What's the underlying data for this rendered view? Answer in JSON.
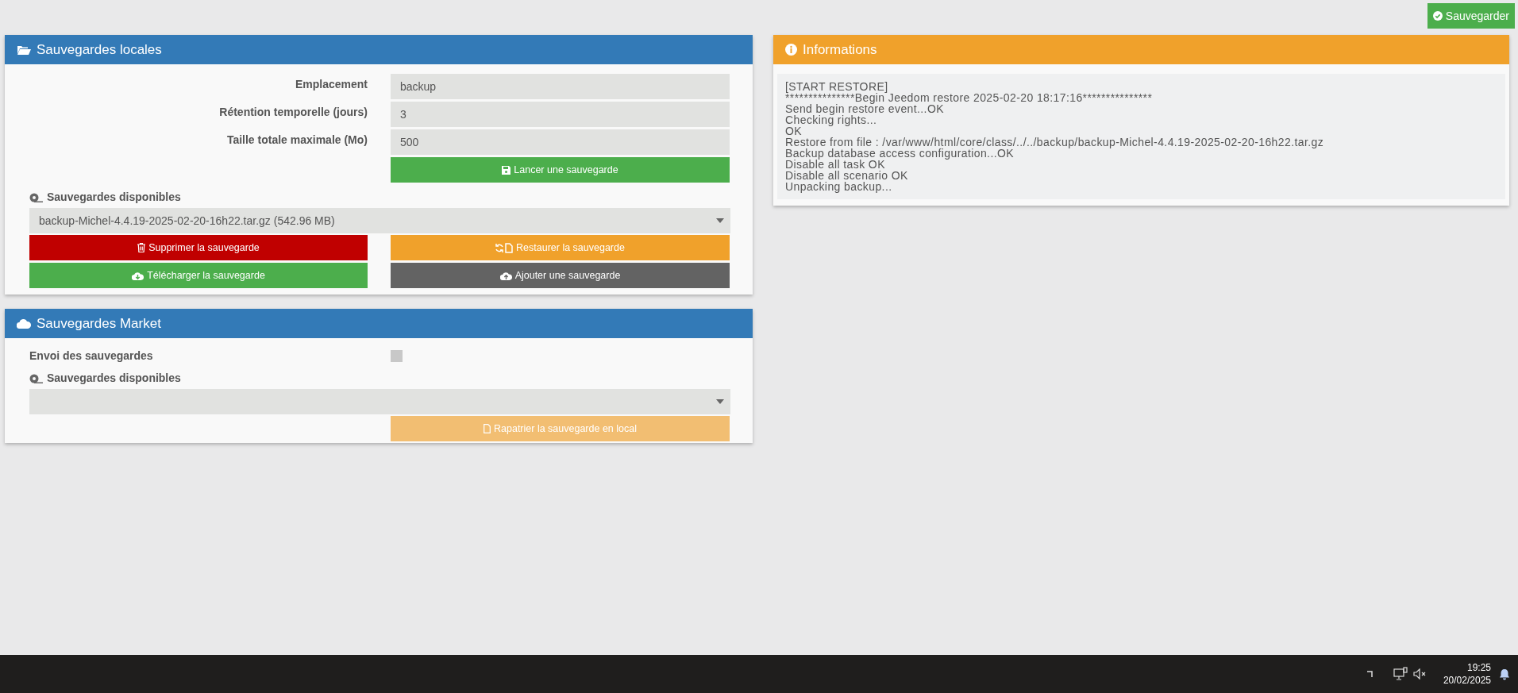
{
  "header_button": {
    "label": "Sauvegarder"
  },
  "local_backups": {
    "title": "Sauvegardes locales",
    "fields": [
      {
        "label": "Emplacement",
        "value": "backup"
      },
      {
        "label": "Rétention temporelle (jours)",
        "value": "3"
      },
      {
        "label": "Taille totale maximale (Mo)",
        "value": "500"
      }
    ],
    "launch_button": "Lancer une sauvegarde",
    "available_label": "Sauvegardes disponibles",
    "select_value": "backup-Michel-4.4.19-2025-02-20-16h22.tar.gz (542.96 MB)",
    "buttons": [
      {
        "label": "Supprimer la sauvegarde",
        "kind": "delete"
      },
      {
        "label": "Restaurer la sauvegarde",
        "kind": "restore"
      },
      {
        "label": "Télécharger la sauvegarde",
        "kind": "download"
      },
      {
        "label": "Ajouter une sauvegarde",
        "kind": "upload"
      }
    ]
  },
  "market_backups": {
    "title": "Sauvegardes Market",
    "send_label": "Envoi des sauvegardes",
    "send_checked": false,
    "available_label": "Sauvegardes disponibles",
    "fetch_button": {
      "label": "Rapatrier la sauvegarde en local",
      "disabled": true
    }
  },
  "info": {
    "title": "Informations",
    "log": [
      "[START RESTORE]",
      "***************Begin Jeedom restore 2025-02-20 18:17:16***************",
      "Send begin restore event...OK",
      "Checking rights...",
      "OK",
      "Restore from file : /var/www/html/core/class/../../backup/backup-Michel-4.4.19-2025-02-20-16h22.tar.gz",
      "Backup database access configuration...OK",
      "Disable all task OK",
      "Disable all scenario OK",
      "Unpacking backup..."
    ]
  },
  "taskbar": {
    "time": "19:25",
    "date": "20/02/2025"
  }
}
